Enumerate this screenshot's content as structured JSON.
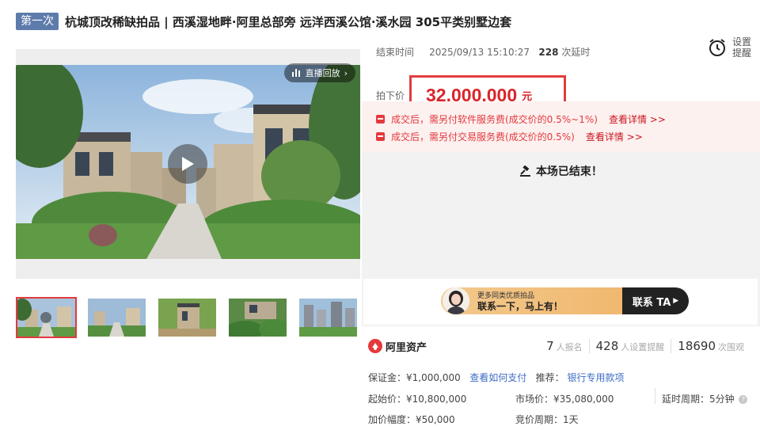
{
  "title": {
    "badge": "第一次",
    "text": "杭城顶改稀缺拍品 | 西溪湿地畔·阿里总部旁 远洋西溪公馆·溪水园 305平类别墅边套"
  },
  "media": {
    "live_label": "直播回放",
    "thumbnail_count": 5
  },
  "auction": {
    "end_label": "结束时间",
    "end_time": "2025/09/13 15:10:27",
    "delay_count": "228",
    "delay_suffix": "次延时",
    "remind_label": "设置提醒",
    "price_label": "拍下价",
    "price": "32,000,000",
    "price_unit": "元"
  },
  "notices": [
    {
      "text": "成交后，需另付软件服务费(成交价的0.5%~1%)",
      "link": "查看详情 >>"
    },
    {
      "text": "成交后，需另付交易服务费(成交价的0.5%)",
      "link": "查看详情 >>"
    }
  ],
  "status": {
    "ended_text": "本场已结束！"
  },
  "promo": {
    "sub_text": "更多同类优质拍品",
    "main_text": "联系一下，马上有！",
    "button": "联系 TA"
  },
  "platform": {
    "name": "阿里资产"
  },
  "stats": [
    {
      "num": "7",
      "label": "人报名"
    },
    {
      "num": "428",
      "label": "人设置提醒"
    },
    {
      "num": "18690",
      "label": "次围观"
    }
  ],
  "details": {
    "deposit_label": "保证金：",
    "deposit_value": "¥1,000,000",
    "deposit_link": "查看如何支付",
    "recommend_label": "推荐：",
    "recommend_link": "银行专用款项",
    "start_label": "起始价：",
    "start_value": "¥10,800,000",
    "market_label": "市场价：",
    "market_value": "¥35,080,000",
    "delay_label": "延时周期：",
    "delay_value": "5分钟",
    "increment_label": "加价幅度：",
    "increment_value": "¥50,000",
    "cycle_label": "竞价周期：",
    "cycle_value": "1天"
  },
  "colors": {
    "accent_red": "#e4393c",
    "badge_blue": "#5d7bab",
    "link_blue": "#3d6dc3",
    "promo_gold": "#f0b870"
  }
}
